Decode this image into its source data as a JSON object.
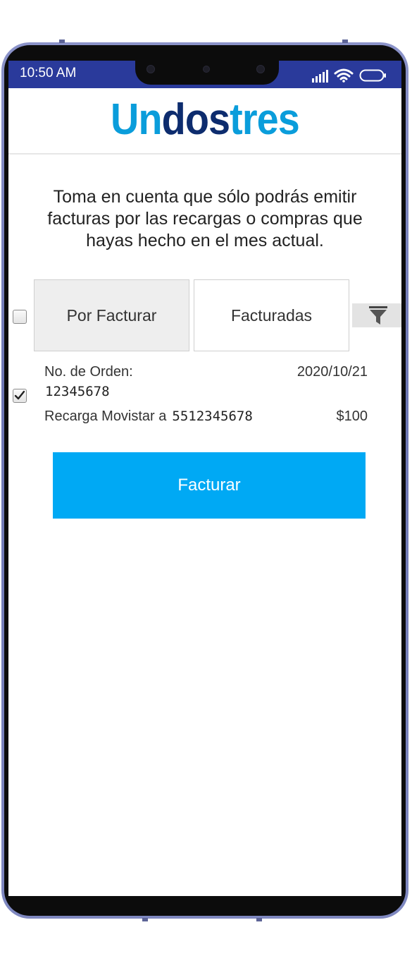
{
  "status_bar": {
    "time": "10:50 AM",
    "background": "#2a3a9b"
  },
  "brand": {
    "part_a": "Un",
    "part_b": "dos",
    "part_c": "tres",
    "color_light": "#0a9ddb",
    "color_dark": "#0d2c6e"
  },
  "notice": {
    "text": "Toma en cuenta que sólo podrás emitir facturas por las recargas o compras que hayas hecho en el mes actual."
  },
  "tabs": [
    {
      "label": "Por Facturar",
      "active": true
    },
    {
      "label": "Facturadas",
      "active": false
    }
  ],
  "filter": {
    "icon": "filter-icon"
  },
  "select_all": {
    "checked": false
  },
  "orders": [
    {
      "label": "No. de Orden:",
      "number": "12345678",
      "date": "2020/10/21",
      "description": "Recarga Movistar a",
      "phone": "5512345678",
      "amount": "$100",
      "checked": true
    }
  ],
  "actions": {
    "invoice_label": "Facturar",
    "invoice_color": "#00a9f4"
  }
}
